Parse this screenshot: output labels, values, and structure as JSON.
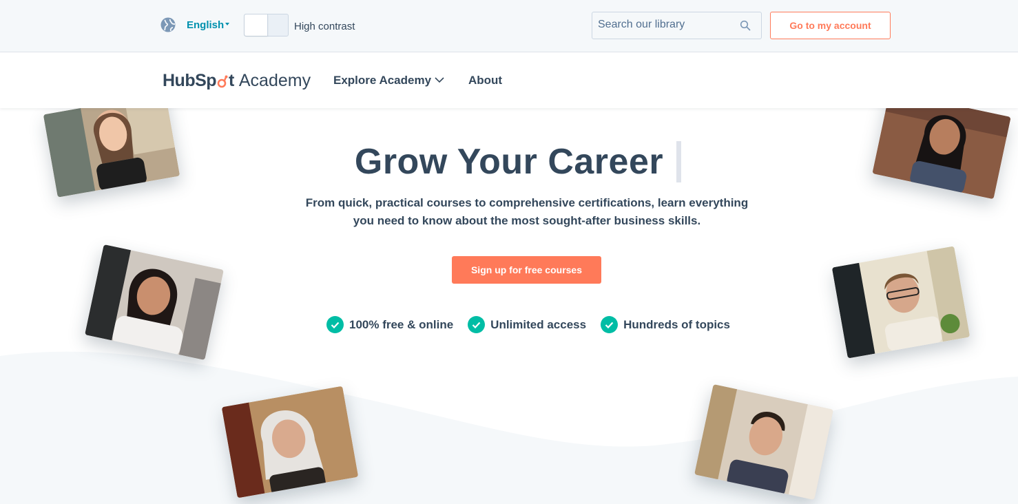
{
  "utility_bar": {
    "language": "English",
    "contrast_label": "High contrast",
    "search_placeholder": "Search our library",
    "account_button": "Go to my account"
  },
  "nav": {
    "logo_brand": "HubSpot",
    "logo_product": "Academy",
    "items": [
      {
        "label": "Explore Academy",
        "has_dropdown": true
      },
      {
        "label": "About",
        "has_dropdown": false
      }
    ]
  },
  "hero": {
    "headline": "Grow Your Career",
    "subtext": "From quick, practical courses to comprehensive certifications, learn everything you need to know about the most sought-after business skills.",
    "cta": "Sign up for free courses",
    "features": [
      "100% free & online",
      "Unlimited access",
      "Hundreds of topics"
    ]
  },
  "colors": {
    "accent": "#ff7a59",
    "text": "#33475b",
    "link": "#0091ae",
    "check": "#00bda5",
    "utility_bg": "#f5f8fa"
  },
  "icons": [
    "globe-icon",
    "search-icon",
    "chevron-down-icon",
    "check-icon",
    "sprocket-icon"
  ]
}
